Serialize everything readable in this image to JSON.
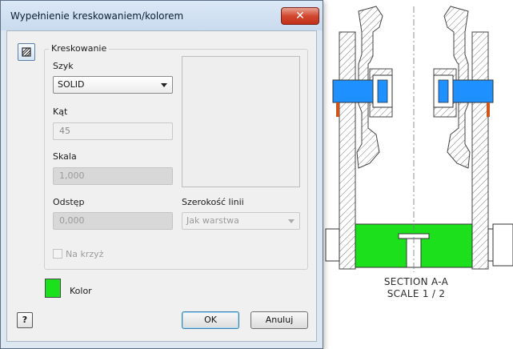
{
  "dialog": {
    "title": "Wypełnienie kreskowaniem/kolorem",
    "close_glyph": "✕",
    "group_label": "Kreskowanie",
    "pattern": {
      "label": "Szyk",
      "value": "SOLID"
    },
    "angle": {
      "label": "Kąt",
      "value": "45"
    },
    "scale": {
      "label": "Skala",
      "value": "1,000"
    },
    "spacing": {
      "label": "Odstęp",
      "value": "0,000"
    },
    "lineweight": {
      "label": "Szerokość linii",
      "value": "Jak warstwa"
    },
    "crosshatch": {
      "label": "Na krzyż",
      "checked": false
    },
    "color": {
      "label": "Kolor",
      "swatch": "#1ce01c"
    },
    "help_glyph": "?",
    "ok_label": "OK",
    "cancel_label": "Anuluj"
  },
  "drawing": {
    "section_title": "SECTION A-A",
    "section_scale": "SCALE 1 / 2",
    "colors": {
      "hatch_fill": "#1ce01c",
      "shaft": "#1e90ff",
      "bearing": "#d0551b",
      "line": "#4a4a4a"
    }
  }
}
